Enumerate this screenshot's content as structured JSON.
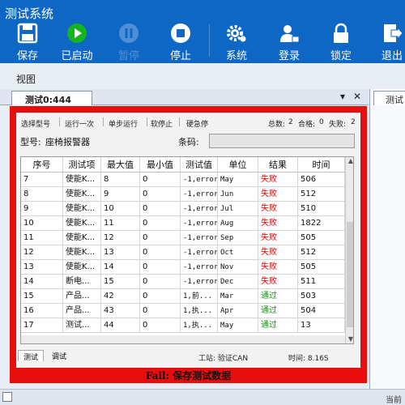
{
  "app": {
    "title": "测试系统"
  },
  "toolbar": {
    "buttons": [
      {
        "label": "保存",
        "icon": "save-icon",
        "enabled": true
      },
      {
        "label": "已启动",
        "icon": "play-icon",
        "enabled": true,
        "color": "#12b51e"
      },
      {
        "label": "暂停",
        "icon": "pause-icon",
        "enabled": false
      },
      {
        "label": "停止",
        "icon": "stop-icon",
        "enabled": true
      },
      {
        "label": "系统",
        "icon": "gear-icon",
        "enabled": true
      },
      {
        "label": "登录",
        "icon": "user-lock-icon",
        "enabled": true
      },
      {
        "label": "锁定",
        "icon": "lock-icon",
        "enabled": true
      },
      {
        "label": "退出",
        "icon": "exit-icon",
        "enabled": true
      }
    ]
  },
  "view": {
    "label": "视图"
  },
  "doc_tab": {
    "label": "测试0:444",
    "right_tab_label": "测试"
  },
  "tools": {
    "select_model": "选择型号",
    "run_once": "运行一次",
    "single_step": "单步运行",
    "soft_stop": "软停止",
    "hard_stop": "硬急停",
    "total_label": "总数:",
    "total": "2",
    "pass_label": "合格:",
    "pass": "0",
    "fail_label": "失败:",
    "fail": "2"
  },
  "model": {
    "label": "型号:",
    "value": "座椅报警器",
    "barcode_label": "条码:",
    "barcode_value": ""
  },
  "table": {
    "headers": [
      "序号",
      "测试项",
      "最大值",
      "最小值",
      "测试值",
      "单位",
      "结果",
      "时间"
    ],
    "rows": [
      [
        "7",
        "使能K...",
        "8",
        "0",
        "-1,error",
        "May",
        "失败",
        "506"
      ],
      [
        "8",
        "使能K...",
        "9",
        "0",
        "-1,error",
        "Jun",
        "失败",
        "512"
      ],
      [
        "9",
        "使能K...",
        "10",
        "0",
        "-1,error",
        "Jul",
        "失败",
        "510"
      ],
      [
        "10",
        "使能K...",
        "11",
        "0",
        "-1,error",
        "Aug",
        "失败",
        "1822"
      ],
      [
        "11",
        "使能K...",
        "12",
        "0",
        "-1,error",
        "Sep",
        "失败",
        "505"
      ],
      [
        "12",
        "使能K...",
        "13",
        "0",
        "-1,error",
        "Oct",
        "失败",
        "512"
      ],
      [
        "13",
        "使能K...",
        "14",
        "0",
        "-1,error",
        "Nov",
        "失败",
        "505"
      ],
      [
        "14",
        "断电...",
        "15",
        "0",
        "-1,error",
        "Dec",
        "失败",
        "511"
      ],
      [
        "15",
        "产品...",
        "42",
        "0",
        "1,前...",
        "Mar",
        "通过",
        "503"
      ],
      [
        "16",
        "产品...",
        "43",
        "0",
        "1,执...",
        "Apr",
        "通过",
        "504"
      ],
      [
        "17",
        "测试...",
        "44",
        "0",
        "1,执...",
        "May",
        "通过",
        "13"
      ]
    ]
  },
  "bottom": {
    "tab_test": "测试",
    "tab_debug": "调试",
    "station": "工站: 验证CAN",
    "time": "时间: 8.16S"
  },
  "banner": {
    "text": "Fail: 保存测试数据"
  },
  "statusbar": {
    "right": "当前"
  },
  "colors": {
    "topbar": "#0e67c4",
    "frame": "#e80e0e",
    "fail": "#e00000",
    "pass": "#1d8a1d"
  }
}
